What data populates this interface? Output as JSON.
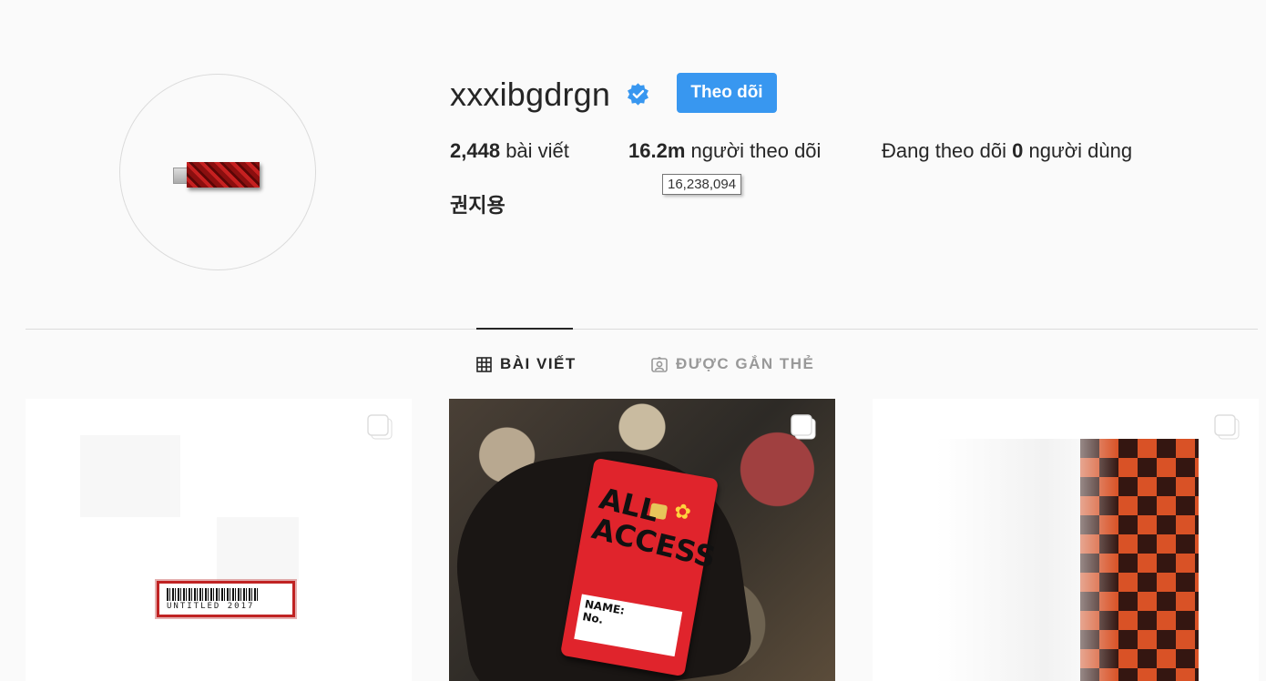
{
  "profile": {
    "username": "xxxibgdrgn",
    "verified": true,
    "follow_label": "Theo dõi",
    "full_name": "권지용",
    "stats": {
      "posts_count": "2,448",
      "posts_label": "bài viết",
      "followers_count": "16.2m",
      "followers_label": "người theo dõi",
      "following_prefix": "Đang theo dõi",
      "following_count": "0",
      "following_label": "người dùng"
    },
    "followers_tooltip": "16,238,094"
  },
  "tabs": [
    {
      "label": "BÀI VIẾT",
      "icon": "grid-icon",
      "active": true
    },
    {
      "label": "ĐƯỢC GẮN THẺ",
      "icon": "tagged-user-icon",
      "active": false
    }
  ],
  "posts": [
    {
      "icon": "multi-photo-icon",
      "caption_art": "UNTITLED 2017"
    },
    {
      "icon": "multi-photo-icon",
      "card_title": "ALL ACCESS",
      "card_field_1": "NAME:",
      "card_field_2": "No."
    },
    {
      "icon": "multi-photo-icon"
    }
  ],
  "colors": {
    "accent": "#3897f0",
    "verified": "#3897f0",
    "text": "#262626",
    "muted": "#999999",
    "divider": "#dbdbdb",
    "background": "#fafafa"
  }
}
